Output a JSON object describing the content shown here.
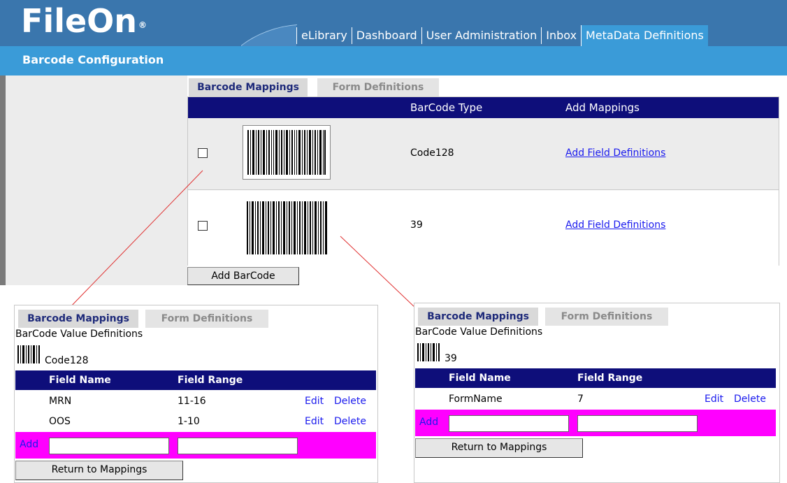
{
  "app": {
    "logo": "FileOn",
    "logo_mark": "®"
  },
  "nav": {
    "items": [
      "eLibrary",
      "Dashboard",
      "User Administration",
      "Inbox",
      "MetaData Definitions"
    ]
  },
  "page": {
    "title": "Barcode Configuration"
  },
  "main": {
    "tabs": [
      "Barcode Mappings",
      "Form Definitions"
    ],
    "columns": {
      "type": "BarCode Type",
      "mappings": "Add Mappings"
    },
    "rows": [
      {
        "type": "Code128",
        "action": "Add Field Definitions"
      },
      {
        "type": "39",
        "action": "Add Field Definitions"
      }
    ],
    "add_button": "Add BarCode"
  },
  "detail_left": {
    "tabs": [
      "Barcode Mappings",
      "Form Definitions"
    ],
    "heading": "BarCode Value Definitions",
    "barcode_type": "Code128",
    "columns": {
      "name": "Field Name",
      "range": "Field Range"
    },
    "rows": [
      {
        "name": "MRN",
        "range": "11-16",
        "edit": "Edit",
        "delete": "Delete"
      },
      {
        "name": "OOS",
        "range": "1-10",
        "edit": "Edit",
        "delete": "Delete"
      }
    ],
    "add_label": "Add",
    "return_button": "Return to Mappings"
  },
  "detail_right": {
    "tabs": [
      "Barcode Mappings",
      "Form Definitions"
    ],
    "heading": "BarCode Value Definitions",
    "barcode_type": "39",
    "columns": {
      "name": "Field Name",
      "range": "Field Range"
    },
    "rows": [
      {
        "name": "FormName",
        "range": "7",
        "edit": "Edit",
        "delete": "Delete"
      }
    ],
    "add_label": "Add",
    "return_button": "Return to Mappings"
  },
  "colors": {
    "header": "#3a76ad",
    "subbar": "#3a9bd8",
    "grid_header": "#0e0e7a",
    "add_row": "#ff00ff",
    "connector": "#e03030"
  }
}
